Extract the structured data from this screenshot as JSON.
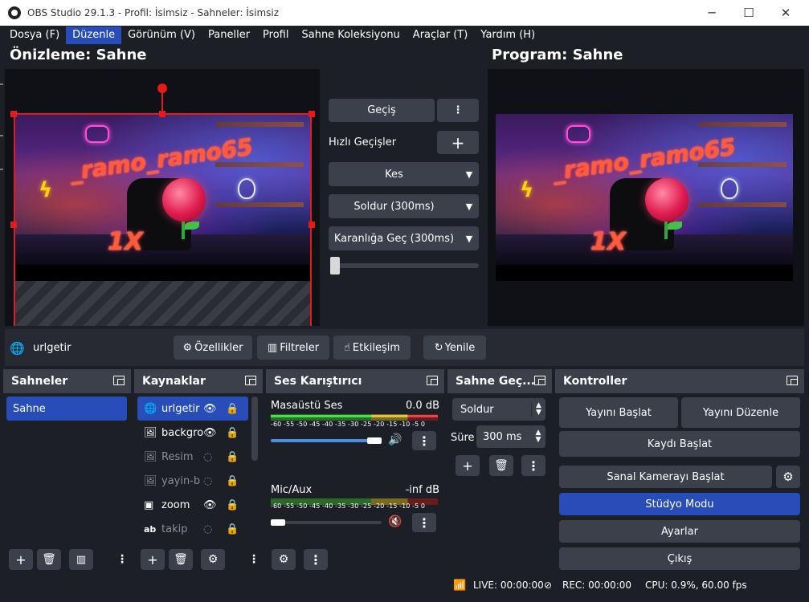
{
  "window": {
    "title": "OBS Studio 29.1.3 - Profil: İsimsiz - Sahneler: İsimsiz",
    "minimize_glyph": "─",
    "maximize_glyph": "☐",
    "close_glyph": "✕"
  },
  "menu": [
    {
      "label": "Dosya (F)",
      "active": false
    },
    {
      "label": "Düzenle",
      "active": true
    },
    {
      "label": "Görünüm (V)",
      "active": false
    },
    {
      "label": "Paneller",
      "active": false
    },
    {
      "label": "Profil",
      "active": false
    },
    {
      "label": "Sahne Koleksiyonu",
      "active": false
    },
    {
      "label": "Araçlar (T)",
      "active": false
    },
    {
      "label": "Yardım (H)",
      "active": false
    }
  ],
  "preview": {
    "title": "Önizleme: Sahne",
    "overlay_text": "_ramo_ramo65",
    "overlay_sub": "1X"
  },
  "program": {
    "title": "Program: Sahne",
    "overlay_text": "_ramo_ramo65",
    "overlay_sub": "1X"
  },
  "transitions": {
    "transition_button": "Geçiş",
    "quick_label": "Hızlı Geçişler",
    "items": [
      "Kes",
      "Soldur (300ms)",
      "Karanlığa Geç (300ms)"
    ],
    "tbar_position": 0
  },
  "context_bar": {
    "source_name": "urlgetir",
    "properties_label": "Özellikler",
    "filters_label": "Filtreler",
    "interact_label": "Etkileşim",
    "refresh_label": "Yenile"
  },
  "scenes": {
    "title": "Sahneler",
    "items": [
      {
        "label": "Sahne",
        "selected": true
      }
    ]
  },
  "sources": {
    "title": "Kaynaklar",
    "items": [
      {
        "label": "urlgetir",
        "icon": "globe-icon",
        "visible": true,
        "selected": true
      },
      {
        "label": "backgro",
        "icon": "image-icon",
        "visible": true,
        "selected": false
      },
      {
        "label": "Resim",
        "icon": "image-icon",
        "visible": false,
        "selected": false
      },
      {
        "label": "yayin-b",
        "icon": "image-icon",
        "visible": false,
        "selected": false
      },
      {
        "label": "zoom",
        "icon": "window-capture-icon",
        "visible": true,
        "selected": false
      },
      {
        "label": "takip",
        "icon": "text-icon",
        "visible": false,
        "selected": false
      }
    ]
  },
  "mixer": {
    "title": "Ses Karıştırıcı",
    "scale": "-60 -55 -50 -45 -40 -35 -30 -25 -20 -15 -10 -5 0",
    "channels": [
      {
        "name": "Masaüstü Ses",
        "level": "0.0 dB",
        "muted": false,
        "volume": 1.0,
        "peak": 1.0
      },
      {
        "name": "Mic/Aux",
        "level": "-inf dB",
        "muted": true,
        "volume": 0.0,
        "peak": 0.0
      }
    ]
  },
  "scene_transitions": {
    "title": "Sahne Geç...",
    "type": "Soldur",
    "duration_label": "Süre",
    "duration_value": "300 ms"
  },
  "controls": {
    "title": "Kontroller",
    "start_stream": "Yayını Başlat",
    "edit_stream": "Yayını Düzenle",
    "start_record": "Kaydı Başlat",
    "start_virtualcam": "Sanal Kamerayı Başlat",
    "studio_mode": "Stüdyo Modu",
    "settings": "Ayarlar",
    "exit": "Çıkış"
  },
  "status": {
    "live": "LIVE: 00:00:00",
    "rec": "REC: 00:00:00",
    "cpu": "CPU: 0.9%, 60.00 fps"
  },
  "colors": {
    "accent": "#284cb8",
    "background": "#1d1f26",
    "panel": "#272a33",
    "button": "#3c404b",
    "selection": "#e21b1b"
  }
}
